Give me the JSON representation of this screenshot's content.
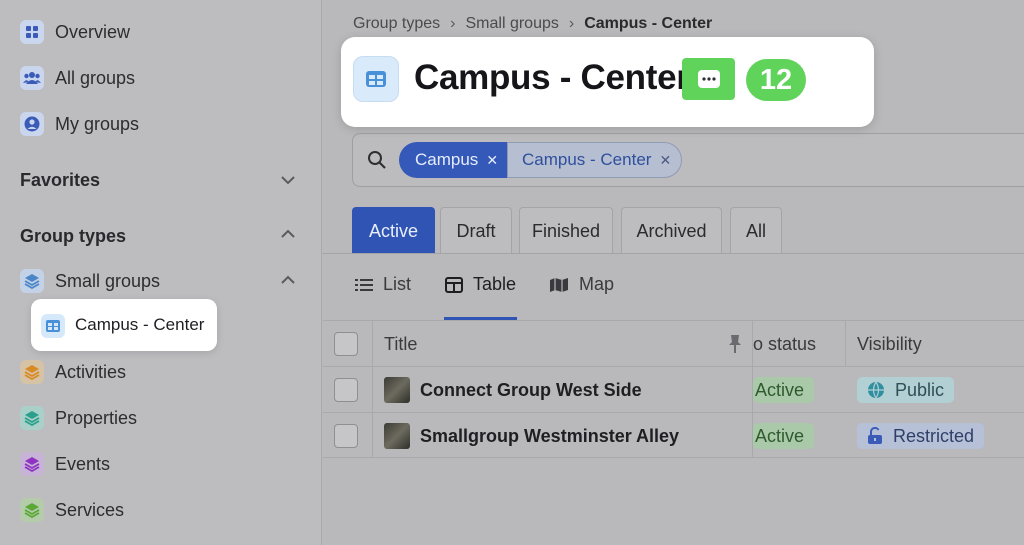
{
  "sidebar": {
    "items": [
      {
        "label": "Overview",
        "icon": "grid-icon"
      },
      {
        "label": "All groups",
        "icon": "people-icon"
      },
      {
        "label": "My groups",
        "icon": "user-circle-icon"
      }
    ],
    "favorites_title": "Favorites",
    "group_types_title": "Group types",
    "group_types": [
      {
        "label": "Small groups",
        "icon": "layers-icon",
        "color": "#4a90d9"
      },
      {
        "label": "Campus - Center",
        "icon": "table-icon",
        "color": "#4a90d9"
      },
      {
        "label": "Activities",
        "icon": "layers-icon",
        "color": "#e0922e"
      },
      {
        "label": "Properties",
        "icon": "layers-icon",
        "color": "#2bb5a0"
      },
      {
        "label": "Events",
        "icon": "layers-icon",
        "color": "#9b3fd0"
      },
      {
        "label": "Services",
        "icon": "layers-icon",
        "color": "#5cb83a"
      }
    ]
  },
  "breadcrumb": {
    "items": [
      "Group types",
      "Small groups"
    ],
    "current": "Campus - Center"
  },
  "header": {
    "title": "Campus - Center",
    "count": "12"
  },
  "filters": {
    "chips": [
      {
        "label": "Campus"
      },
      {
        "label": "Campus - Center"
      }
    ]
  },
  "status_tabs": [
    "Active",
    "Draft",
    "Finished",
    "Archived",
    "All"
  ],
  "view_tabs": [
    "List",
    "Table",
    "Map"
  ],
  "table": {
    "columns": [
      "Title",
      "o status",
      "Visibility"
    ],
    "rows": [
      {
        "title": "Connect Group West Side",
        "status": "Active",
        "visibility": "Public"
      },
      {
        "title": "Smallgroup Westminster Alley",
        "status": "Active",
        "visibility": "Restricted"
      }
    ]
  },
  "colors": {
    "accent": "#2f54b3",
    "highlight_green": "#5fd35a"
  }
}
